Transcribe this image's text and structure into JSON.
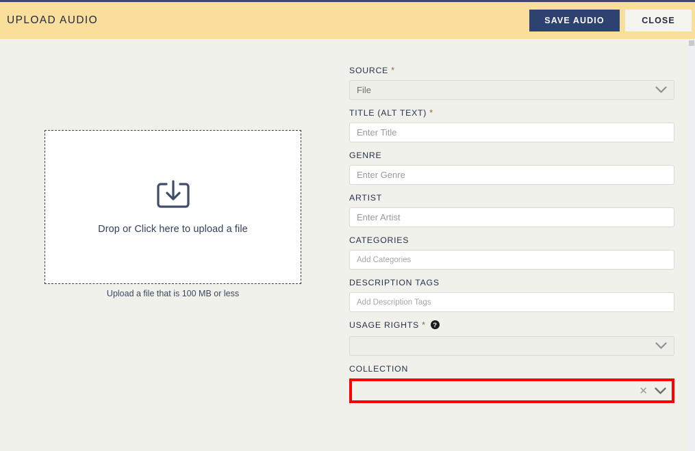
{
  "header": {
    "title": "UPLOAD AUDIO",
    "save_label": "SAVE AUDIO",
    "close_label": "CLOSE",
    "background_color": "#F9DE9C",
    "save_color": "#2E4271"
  },
  "upload": {
    "icon": "download-tray-icon",
    "dropzone_label": "Drop or Click here to upload a file",
    "hint": "Upload a file that is 100 MB or less"
  },
  "form": {
    "source": {
      "label": "SOURCE",
      "required": "*",
      "value": "File",
      "icon": "chevron-down-icon"
    },
    "title": {
      "label": "TITLE (ALT TEXT)",
      "required": "*",
      "value": "",
      "placeholder": "Enter Title"
    },
    "genre": {
      "label": "GENRE",
      "value": "",
      "placeholder": "Enter Genre"
    },
    "artist": {
      "label": "ARTIST",
      "value": "",
      "placeholder": "Enter Artist"
    },
    "categories": {
      "label": "CATEGORIES",
      "value": "",
      "placeholder": "Add Categories"
    },
    "description_tags": {
      "label": "DESCRIPTION TAGS",
      "value": "",
      "placeholder": "Add Description Tags"
    },
    "usage_rights": {
      "label": "USAGE RIGHTS",
      "required": "*",
      "value": "",
      "help_icon": "question-mark-circle-icon",
      "icon": "chevron-down-icon"
    },
    "collection": {
      "label": "COLLECTION",
      "value": "",
      "clear_icon": "clear-x-icon",
      "icon": "chevron-down-icon",
      "highlight_color": "#FF0000"
    }
  }
}
